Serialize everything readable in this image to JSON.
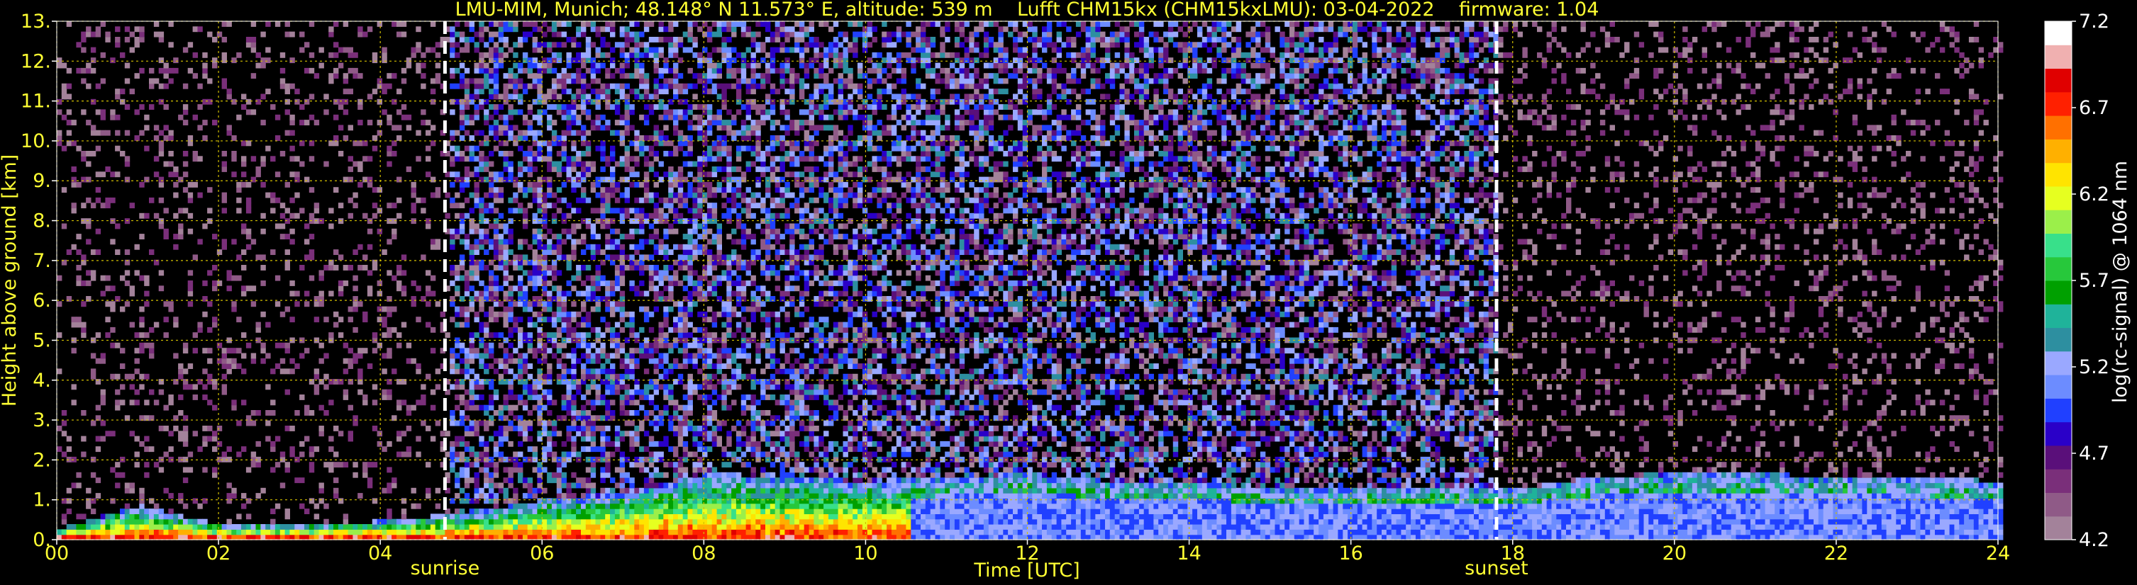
{
  "chart_data": {
    "type": "heatmap",
    "title": "LMU-MIM, Munich; 48.148° N 11.573° E, altitude: 539 m    Lufft CHM15kx (CHM15kxLMU): 03-04-2022    firmware: 1.04",
    "xlabel": "Time [UTC]",
    "ylabel": "Height above ground [km]",
    "xlim": [
      0,
      24
    ],
    "ylim": [
      0,
      13
    ],
    "x_tick_labels": [
      "00",
      "02",
      "04",
      "06",
      "08",
      "10",
      "12",
      "14",
      "16",
      "18",
      "20",
      "22",
      "24"
    ],
    "y_tick_labels": [
      "0.",
      "1.",
      "2.",
      "3.",
      "4.",
      "5.",
      "6.",
      "7.",
      "8.",
      "9.",
      "10.",
      "11.",
      "12.",
      "13."
    ],
    "grid": true,
    "vertical_markers": [
      {
        "label": "sunrise",
        "x": 4.8
      },
      {
        "label": "sunset",
        "x": 17.8
      }
    ],
    "colorbar": {
      "label": "log(rc-signal) @ 1064 nm",
      "tick_labels": [
        "4.2",
        "4.7",
        "5.2",
        "5.7",
        "6.2",
        "6.7",
        "7.2"
      ],
      "range": [
        4.2,
        7.2
      ]
    },
    "layer_profile": {
      "description_free": true,
      "times": [
        0,
        1,
        2,
        3,
        4,
        5,
        6,
        7,
        8,
        9,
        10,
        11,
        12,
        13,
        14,
        15,
        16,
        17,
        18,
        19,
        20,
        21,
        22,
        23,
        24
      ],
      "top_km": [
        0.2,
        0.8,
        0.3,
        0.3,
        0.4,
        0.6,
        0.9,
        1.1,
        1.6,
        1.5,
        1.4,
        1.5,
        1.6,
        1.4,
        1.4,
        1.2,
        1.2,
        1.3,
        1.2,
        1.5,
        1.6,
        1.6,
        1.5,
        1.5,
        1.4
      ]
    }
  },
  "colors": {
    "axis_text": "#ffff33",
    "grid": "#d4c000",
    "marker": "#ffffff",
    "colorbar_text": "#ffffff",
    "colormap": [
      "#a3829a",
      "#8f5a87",
      "#7a2f7a",
      "#5a0f7a",
      "#2a00c8",
      "#2040ff",
      "#6c8cff",
      "#9aa8ff",
      "#2d8fa0",
      "#1fb39a",
      "#00a000",
      "#27c83b",
      "#38e08a",
      "#9bef4a",
      "#e6ff20",
      "#ffe400",
      "#ffb000",
      "#ff7000",
      "#ff2000",
      "#e00000",
      "#f0b0b0",
      "#ffffff"
    ]
  }
}
